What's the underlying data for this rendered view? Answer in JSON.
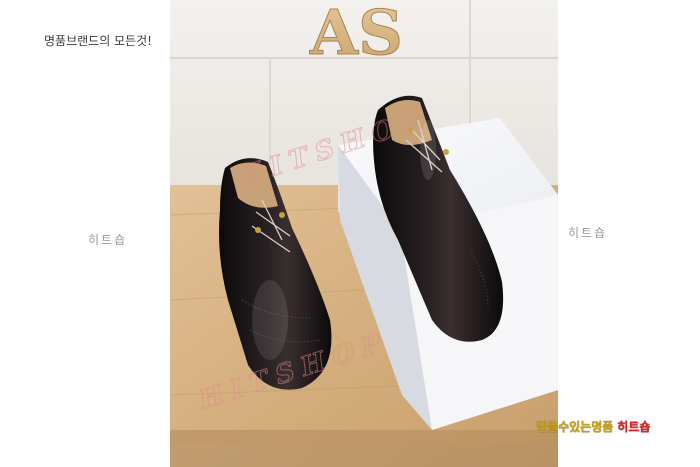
{
  "header": {
    "tagline": "명품브랜드의 모든것!"
  },
  "side_watermarks": {
    "left": "히트숍",
    "right": "히트숍"
  },
  "photo": {
    "sign_letters": "AS",
    "watermark": "HITSHOP",
    "colors": {
      "wall": "#f1efec",
      "wood": "#d8b587",
      "box": "#f4f4f6",
      "leather": "#141012"
    }
  },
  "footer": {
    "slogan": "믿을수있는명품",
    "brand": "히트숍"
  }
}
